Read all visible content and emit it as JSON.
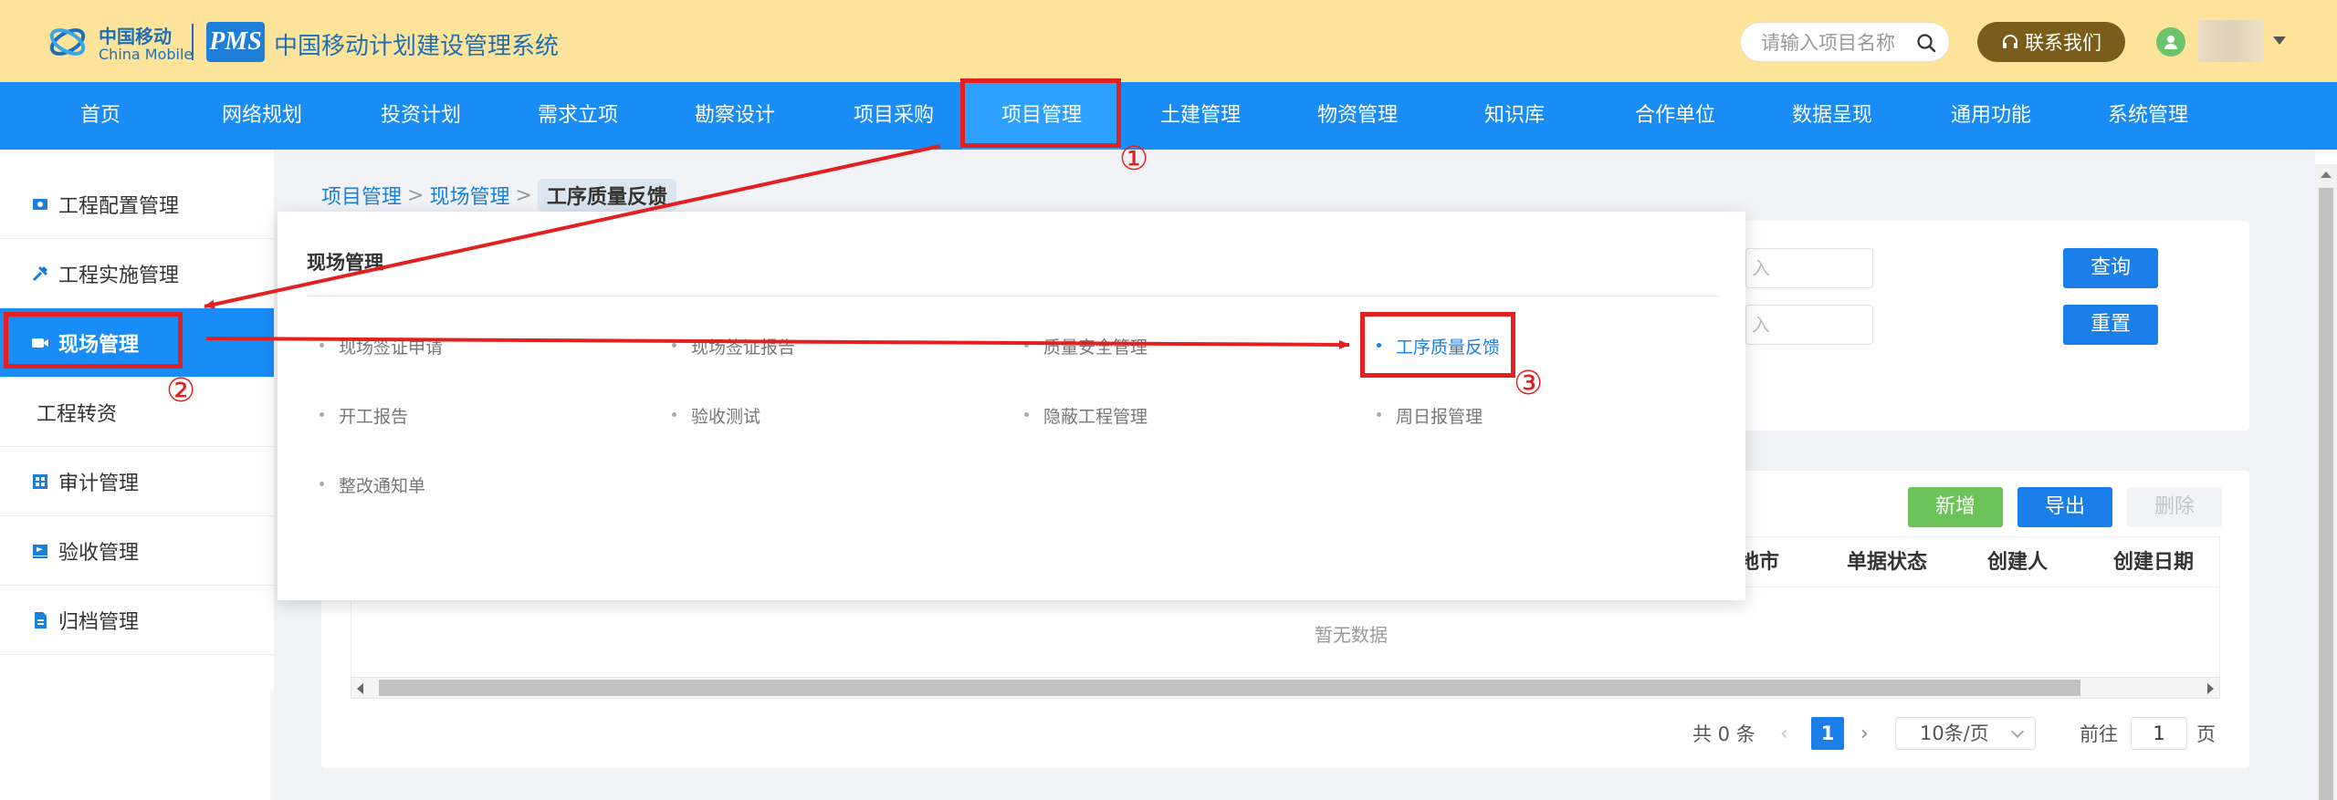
{
  "header": {
    "brand_cn": "中国移动",
    "brand_en": "China Mobile",
    "pms_label": "PMS",
    "system_title": "中国移动计划建设管理系统",
    "search_placeholder": "请输入项目名称",
    "contact_label": "联系我们",
    "accent_color": "#1a8cf5",
    "header_bg": "#fde49a"
  },
  "nav": {
    "items": [
      {
        "label": "首页"
      },
      {
        "label": "网络规划"
      },
      {
        "label": "投资计划"
      },
      {
        "label": "需求立项"
      },
      {
        "label": "勘察设计"
      },
      {
        "label": "项目采购"
      },
      {
        "label": "项目管理",
        "active": true
      },
      {
        "label": "土建管理"
      },
      {
        "label": "物资管理"
      },
      {
        "label": "知识库"
      },
      {
        "label": "合作单位"
      },
      {
        "label": "数据呈现"
      },
      {
        "label": "通用功能"
      },
      {
        "label": "系统管理"
      }
    ]
  },
  "sidebar": {
    "items": [
      {
        "label": "工程配置管理",
        "icon": "settings-icon"
      },
      {
        "label": "工程实施管理",
        "icon": "tools-icon"
      },
      {
        "label": "现场管理",
        "icon": "camera-icon",
        "active": true
      },
      {
        "label": "工程转资"
      },
      {
        "label": "审计管理",
        "icon": "grid-icon"
      },
      {
        "label": "验收管理",
        "icon": "flag-icon"
      },
      {
        "label": "归档管理",
        "icon": "document-icon"
      }
    ],
    "collapse_glyph": "«"
  },
  "breadcrumb": {
    "items": [
      "项目管理",
      "现场管理"
    ],
    "separator": ">",
    "current": "工序质量反馈"
  },
  "search_panel": {
    "input_1_placeholder": "入",
    "input_2_placeholder": "入",
    "query_label": "查询",
    "reset_label": "重置"
  },
  "table": {
    "toolbar": {
      "add_label": "新增",
      "export_label": "导出",
      "delete_label": "删除"
    },
    "columns": [
      "地市",
      "单据状态",
      "创建人",
      "创建日期"
    ],
    "empty_text": "暂无数据"
  },
  "pagination": {
    "total_text": "共 0 条",
    "current_page": "1",
    "page_size": "10条/页",
    "goto_label": "前往",
    "goto_value": "1",
    "page_suffix": "页"
  },
  "dropdown": {
    "title": "现场管理",
    "items": [
      {
        "label": "现场签证申请"
      },
      {
        "label": "现场签证报告"
      },
      {
        "label": "质量安全管理"
      },
      {
        "label": "工序质量反馈",
        "highlight": true
      },
      {
        "label": "开工报告"
      },
      {
        "label": "验收测试"
      },
      {
        "label": "隐蔽工程管理"
      },
      {
        "label": "周日报管理"
      },
      {
        "label": "整改通知单"
      }
    ]
  },
  "annotations": {
    "step_1": "①",
    "step_2": "②",
    "step_3": "③",
    "color": "#e32020"
  }
}
